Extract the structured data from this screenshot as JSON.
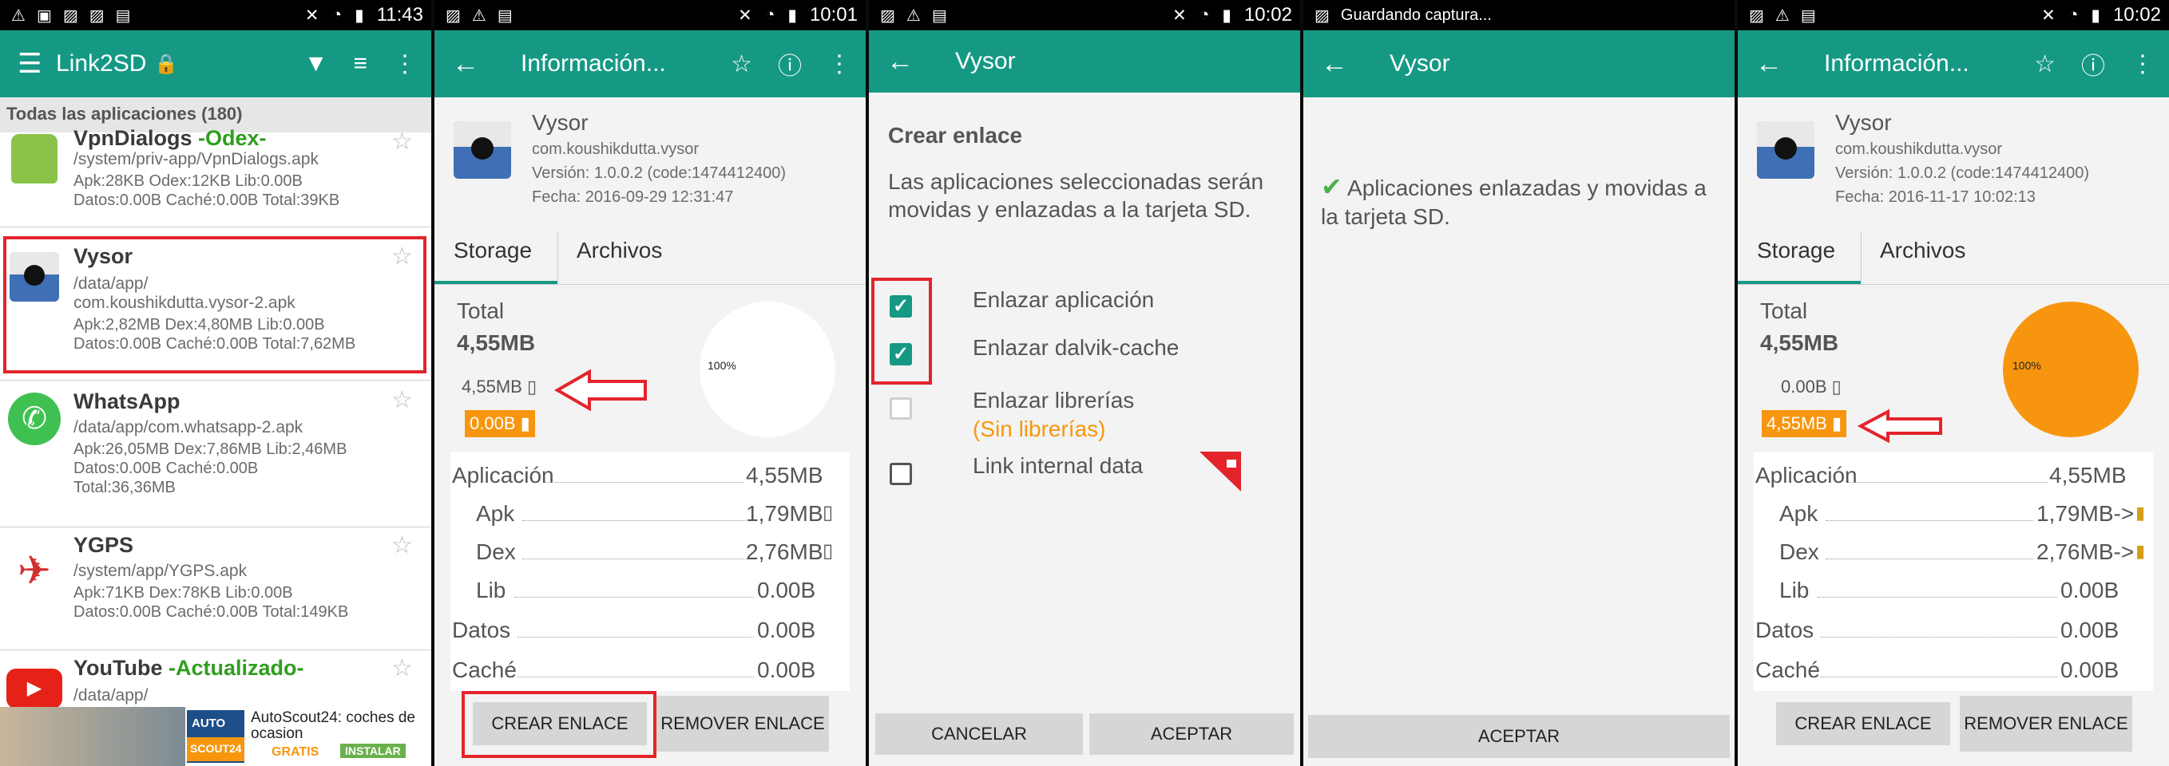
{
  "p1": {
    "status": {
      "time": "11:43",
      "icons": [
        "warning-icon",
        "app-icon",
        "image-icon",
        "image-icon",
        "bag-icon"
      ]
    },
    "toolbar": {
      "title": "Link2SD",
      "lock": "🔒"
    },
    "list_header": "Todas las aplicaciones (180)",
    "apps": [
      {
        "name": "VpnDialogs",
        "tag": "-Odex-",
        "path": "/system/priv-app/VpnDialogs.apk",
        "l1": "Apk:28KB  Odex:12KB  Lib:0.00B",
        "l2": "Datos:0.00B  Caché:0.00B  Total:39KB"
      },
      {
        "name": "Vysor",
        "path": "/data/app/",
        "path2": "com.koushikdutta.vysor-2.apk",
        "l1": "Apk:2,82MB  Dex:4,80MB  Lib:0.00B",
        "l2": "Datos:0.00B  Caché:0.00B  Total:7,62MB"
      },
      {
        "name": "WhatsApp",
        "path": "/data/app/com.whatsapp-2.apk",
        "l1": "Apk:26,05MB  Dex:7,86MB  Lib:2,46MB",
        "l2": "Datos:0.00B  Caché:0.00B",
        "l3": "Total:36,36MB"
      },
      {
        "name": "YGPS",
        "path": "/system/app/YGPS.apk",
        "l1": "Apk:71KB  Dex:78KB  Lib:0.00B",
        "l2": "Datos:0.00B  Caché:0.00B  Total:149KB"
      },
      {
        "name": "YouTube",
        "tag": "-Actualizado-",
        "path": "/data/app/"
      }
    ],
    "ad": {
      "badge1": "AUTO",
      "badge2": "SCOUT24",
      "text": "AutoScout24: coches de ocasion",
      "gratis": "GRATIS",
      "install": "INSTALAR"
    }
  },
  "p2": {
    "status": {
      "time": "10:01"
    },
    "toolbar": {
      "title": "Información..."
    },
    "app": {
      "name": "Vysor",
      "pkg": "com.koushikdutta.vysor",
      "version": "Versión: 1.0.0.2 (code:1474412400)",
      "date": "Fecha: 2016-09-29 12:31:47"
    },
    "tabs": [
      "Storage",
      "Archivos"
    ],
    "total_label": "Total",
    "total_value": "4,55MB",
    "internal": "4,55MB",
    "sd": "0.00B",
    "pie_label": "100%",
    "rows": [
      [
        "Aplicación",
        "4,55MB"
      ],
      [
        "Apk",
        "1,79MB"
      ],
      [
        "Dex",
        "2,76MB"
      ],
      [
        "Lib",
        "0.00B"
      ],
      [
        "Datos",
        "0.00B"
      ],
      [
        "Caché",
        "0.00B"
      ]
    ],
    "btn1": "CREAR ENLACE",
    "btn2": "REMOVER ENLACE"
  },
  "p3": {
    "status": {
      "time": "10:02"
    },
    "toolbar": {
      "title": "Vysor"
    },
    "heading": "Crear enlace",
    "message": "Las aplicaciones seleccionadas serán movidas y enlazadas a la tarjeta SD.",
    "opts": [
      "Enlazar aplicación",
      "Enlazar dalvik-cache",
      "Enlazar librerías",
      "Link internal data"
    ],
    "sin": "(Sin librerías)",
    "cancel": "CANCELAR",
    "accept": "ACEPTAR"
  },
  "p4": {
    "status": {
      "text": "Guardando captura..."
    },
    "toolbar": {
      "title": "Vysor"
    },
    "message": "Aplicaciones enlazadas y movidas a la tarjeta SD.",
    "accept": "ACEPTAR"
  },
  "p5": {
    "status": {
      "time": "10:02"
    },
    "toolbar": {
      "title": "Información..."
    },
    "app": {
      "name": "Vysor",
      "pkg": "com.koushikdutta.vysor",
      "version": "Versión: 1.0.0.2 (code:1474412400)",
      "date": "Fecha: 2016-11-17 10:02:13"
    },
    "tabs": [
      "Storage",
      "Archivos"
    ],
    "total_label": "Total",
    "total_value": "4,55MB",
    "internal": "0.00B",
    "sd": "4,55MB",
    "pie_label": "100%",
    "rows": [
      [
        "Aplicación",
        "4,55MB"
      ],
      [
        "Apk",
        "1,79MB->"
      ],
      [
        "Dex",
        "2,76MB->"
      ],
      [
        "Lib",
        "0.00B"
      ],
      [
        "Datos",
        "0.00B"
      ],
      [
        "Caché",
        "0.00B"
      ]
    ],
    "btn1": "CREAR ENLACE",
    "btn2": "REMOVER ENLACE"
  },
  "colors": {
    "teal": "#159984",
    "orange": "#f7960e",
    "red": "#e3242b",
    "green_tag": "#2e9e1d"
  }
}
